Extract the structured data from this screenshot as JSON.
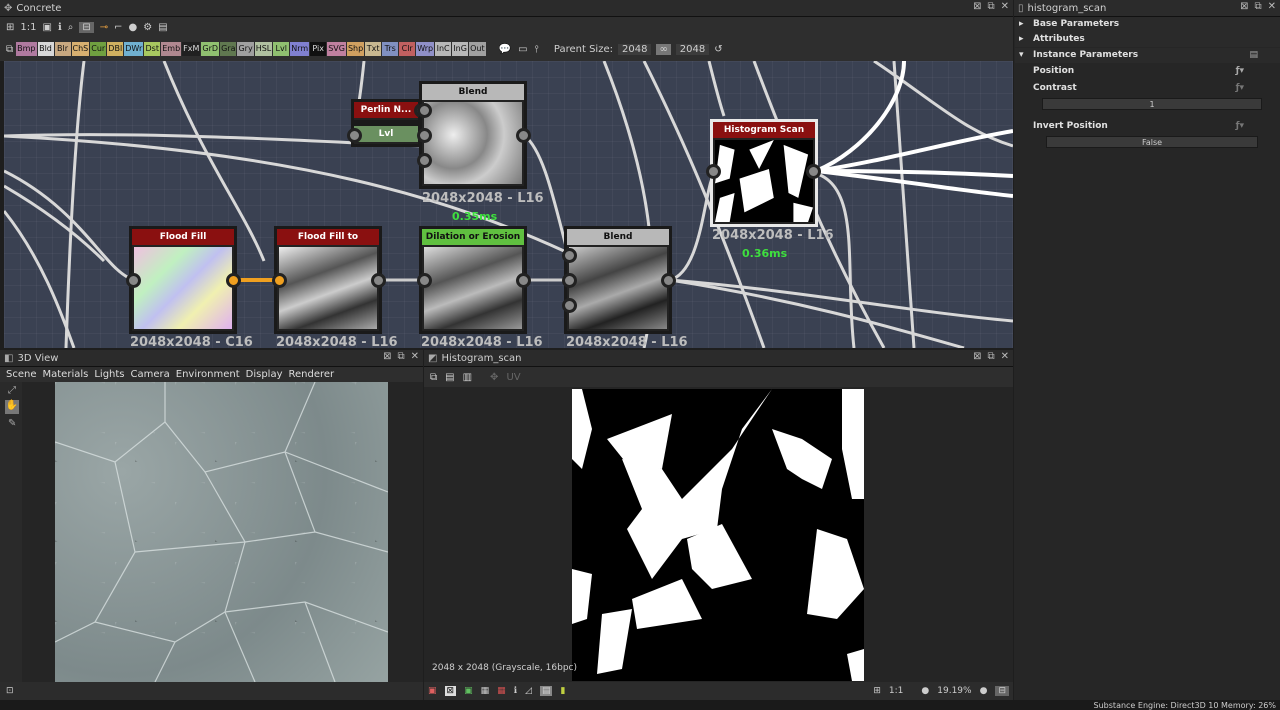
{
  "graph_window": {
    "title": "Concrete",
    "atoms": [
      {
        "label": "Bmp",
        "color": "#b07aa0"
      },
      {
        "label": "Bld",
        "color": "#d8d8d8"
      },
      {
        "label": "Blr",
        "color": "#c8a880"
      },
      {
        "label": "ChS",
        "color": "#d8b070"
      },
      {
        "label": "Cur",
        "color": "#70a040"
      },
      {
        "label": "DBl",
        "color": "#d0b060"
      },
      {
        "label": "DWr",
        "color": "#70b0d0"
      },
      {
        "label": "Dst",
        "color": "#a8c860"
      },
      {
        "label": "Emb",
        "color": "#b08890"
      },
      {
        "label": "FxM",
        "color": "#202020"
      },
      {
        "label": "GrD",
        "color": "#90c070"
      },
      {
        "label": "Gra",
        "color": "#607850"
      },
      {
        "label": "Gry",
        "color": "#a0a0a0"
      },
      {
        "label": "HSL",
        "color": "#b0c0a0"
      },
      {
        "label": "Lvl",
        "color": "#90c070"
      },
      {
        "label": "Nrm",
        "color": "#8080d0"
      },
      {
        "label": "Pix",
        "color": "#101010"
      },
      {
        "label": "SVG",
        "color": "#c080a0"
      },
      {
        "label": "Shp",
        "color": "#d0a060"
      },
      {
        "label": "Txt",
        "color": "#c8b890"
      },
      {
        "label": "Trs",
        "color": "#8090c0"
      },
      {
        "label": "Clr",
        "color": "#c06060"
      },
      {
        "label": "Wrp",
        "color": "#9090c8"
      },
      {
        "label": "InC",
        "color": "#b8b8b8"
      },
      {
        "label": "InG",
        "color": "#b8b8b8"
      },
      {
        "label": "Out",
        "color": "#a0a0a0"
      }
    ],
    "zoom_label": "1:1",
    "parent_size_label": "Parent Size:",
    "parent_size_value": "2048",
    "size_value": "2048",
    "nodes": {
      "perlin": {
        "title": "Perlin N...",
        "color": "#8a1010"
      },
      "lvl": {
        "title": "Lvl",
        "color": "#6a9060"
      },
      "blend_top": {
        "title": "Blend",
        "color": "#b8b8b8",
        "res": "2048x2048 - L16",
        "time": "0.35ms"
      },
      "flood_fill": {
        "title": "Flood Fill",
        "color": "#8a1010",
        "res": "2048x2048 - C16"
      },
      "ff_gradient": {
        "title": "Flood Fill to Gradient",
        "color": "#8a1010",
        "res": "2048x2048 - L16"
      },
      "dilation": {
        "title": "Dilation or Erosion ...",
        "color": "#60c040",
        "res": "2048x2048 - L16"
      },
      "blend_bottom": {
        "title": "Blend",
        "color": "#b8b8b8",
        "res": "2048x2048 - L16"
      },
      "histogram_scan": {
        "title": "Histogram Scan",
        "color": "#8a1010",
        "res": "2048x2048 - L16",
        "time": "0.36ms"
      }
    }
  },
  "view3d": {
    "title": "3D View",
    "menus": [
      "Scene",
      "Materials",
      "Lights",
      "Camera",
      "Environment",
      "Display",
      "Renderer"
    ]
  },
  "view2d": {
    "title": "Histogram_scan",
    "uv_label": "UV",
    "info": "2048 x 2048 (Grayscale, 16bpc)",
    "zoom_ratio": "1:1",
    "zoom_percent": "19.19%"
  },
  "properties": {
    "title": "histogram_scan",
    "sections": [
      "Base Parameters",
      "Attributes",
      "Instance Parameters"
    ],
    "position_label": "Position",
    "contrast_label": "Contrast",
    "contrast_value": "1",
    "invert_label": "Invert Position",
    "invert_value": "False"
  },
  "status": {
    "engine": "Substance Engine: Direct3D 10  Memory: 26%"
  }
}
